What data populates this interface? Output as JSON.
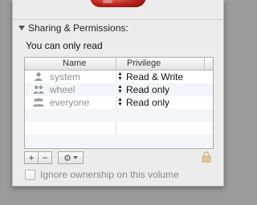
{
  "section": {
    "title": "Sharing & Permissions:"
  },
  "access_text": "You can only read",
  "table": {
    "headers": [
      "Name",
      "Privilege"
    ],
    "rows": [
      {
        "name": "system",
        "icon": "single-user-icon",
        "privilege": "Read & Write"
      },
      {
        "name": "wheel",
        "icon": "group-icon",
        "privilege": "Read only"
      },
      {
        "name": "everyone",
        "icon": "everyone-icon",
        "privilege": "Read only"
      }
    ]
  },
  "buttons": {
    "add": "+",
    "remove": "−",
    "action": "⚙"
  },
  "checkbox": {
    "label": "Ignore ownership on this volume",
    "checked": false
  }
}
